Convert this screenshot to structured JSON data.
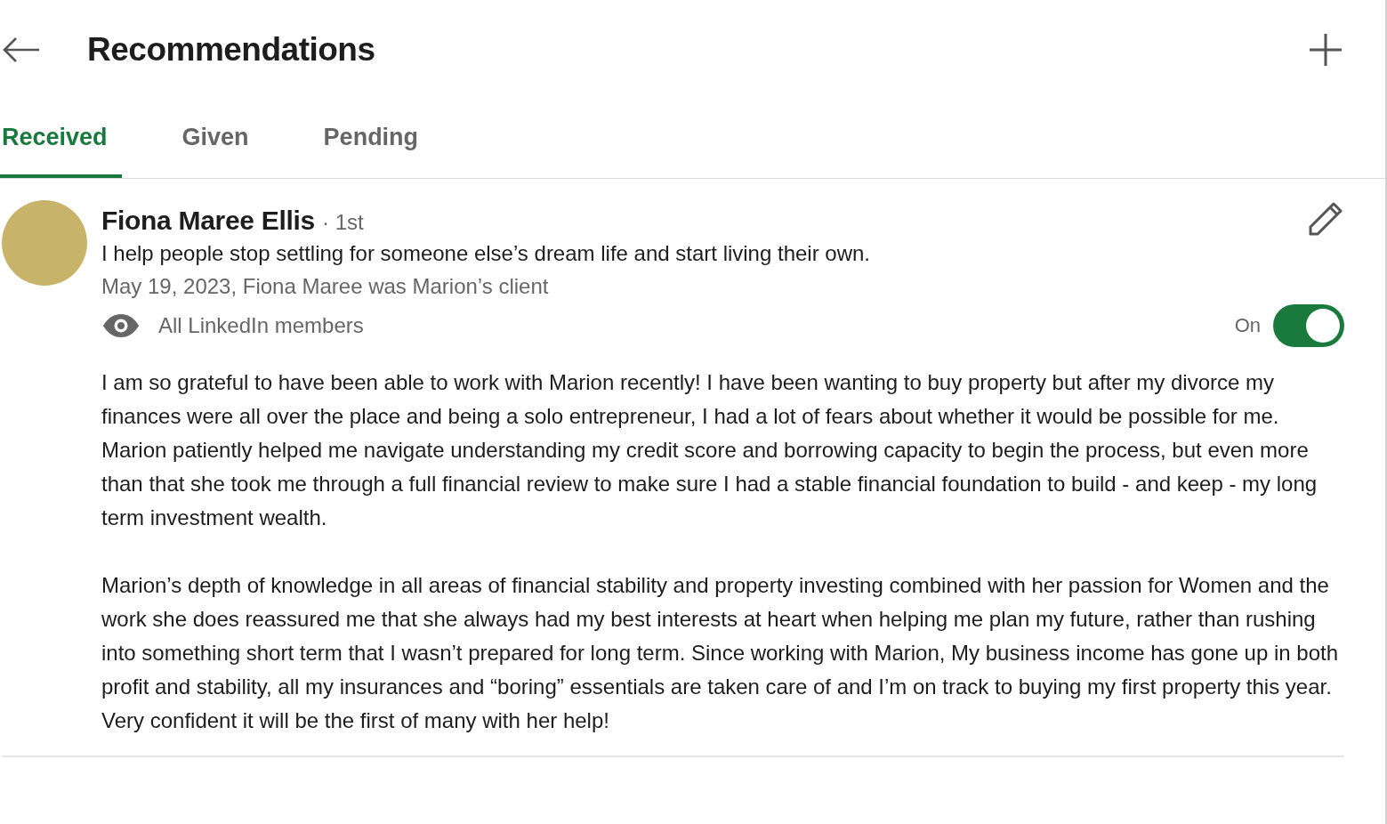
{
  "header": {
    "title": "Recommendations"
  },
  "tabs": [
    {
      "label": "Received",
      "selected": true
    },
    {
      "label": "Given",
      "selected": false
    },
    {
      "label": "Pending",
      "selected": false
    }
  ],
  "recommendation": {
    "name": "Fiona Maree Ellis",
    "degree": "· 1st",
    "headline": "I help people stop settling for someone else’s dream life and start living their own.",
    "meta": "May 19, 2023, Fiona Maree was Marion’s client",
    "visibility": "All LinkedIn members",
    "toggle": {
      "label": "On",
      "on": true
    },
    "paragraphs": [
      "I am so grateful to have been able to work with Marion recently! I have been wanting to buy property but after my divorce my finances were all over the place and being a solo entrepreneur, I had a lot of fears about whether it would be possible for me. Marion patiently helped me navigate understanding my credit score and borrowing capacity to begin the process, but even more than that she took me through a full financial review to make sure I had a stable financial foundation to build - and keep - my long term investment wealth.",
      "Marion’s depth of knowledge in all areas of financial stability and property investing combined with her passion for Women and the work she does reassured me that she always had my best interests at heart when helping me plan my future, rather than rushing into something short term that I wasn’t prepared for long term. Since working with Marion, My business income has gone up in both profit and stability, all my insurances and “boring” essentials are taken care of and I’m on track to buying my first property this year. Very confident it will be the first of many with her help!"
    ]
  }
}
